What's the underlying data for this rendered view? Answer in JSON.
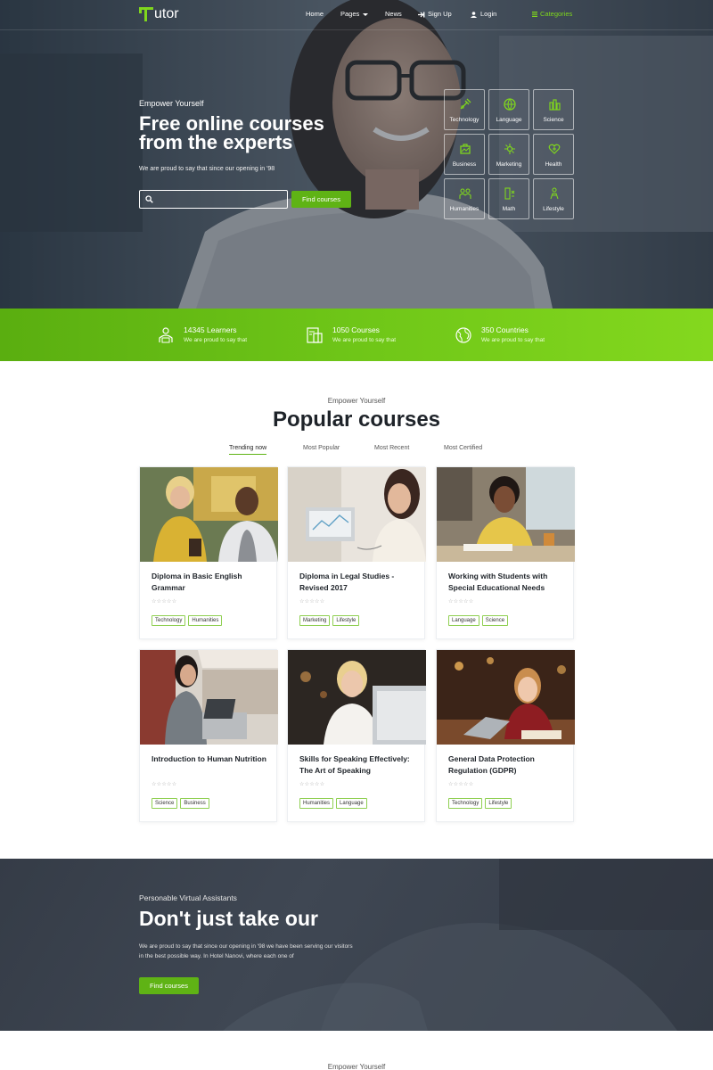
{
  "nav": {
    "logo_letter": "T",
    "logo_text": "utor",
    "home": "Home",
    "pages": "Pages",
    "news": "News",
    "signup": "Sign Up",
    "login": "Login",
    "categories": "Categories"
  },
  "hero": {
    "eyebrow": "Empower Yourself",
    "title_line1": "Free online courses",
    "title_line2": "from the experts",
    "subtitle": "We are proud to say that since our opening in '98",
    "search_placeholder": "",
    "button": "Find courses",
    "categories": [
      "Technology",
      "Language",
      "Science",
      "Business",
      "Marketing",
      "Health",
      "Humanities",
      "Math",
      "Lifestyle"
    ]
  },
  "stats": [
    {
      "number": "14345 Learners",
      "desc": "We are proud to say that",
      "icon": "learners-icon"
    },
    {
      "number": "1050 Courses",
      "desc": "We are proud to say that",
      "icon": "courses-icon"
    },
    {
      "number": "350 Countries",
      "desc": "We are proud to say that",
      "icon": "globe-icon"
    }
  ],
  "popular": {
    "eyebrow": "Empower Yourself",
    "title": "Popular courses",
    "tabs": [
      "Trending now",
      "Most Popular",
      "Most Recent",
      "Most Certified"
    ],
    "stars": "☆☆☆☆☆",
    "courses": [
      {
        "title": "Diploma in Basic English Grammar",
        "tags": [
          "Technology",
          "Humanities"
        ]
      },
      {
        "title": "Diploma in Legal Studies - Revised 2017",
        "tags": [
          "Marketing",
          "Lifestyle"
        ]
      },
      {
        "title": "Working with Students with Special Educational Needs",
        "tags": [
          "Language",
          "Science"
        ]
      },
      {
        "title": "Introduction to Human Nutrition",
        "tags": [
          "Science",
          "Business"
        ]
      },
      {
        "title": "Skills for Speaking Effectively: The Art of Speaking",
        "tags": [
          "Humanities",
          "Language"
        ]
      },
      {
        "title": "General Data Protection Regulation (GDPR)",
        "tags": [
          "Technology",
          "Lifestyle"
        ]
      }
    ]
  },
  "testimonial": {
    "eyebrow": "Personable Virtual Assistants",
    "title": "Don't just take our",
    "text": "We are proud to say that since our opening in '98 we have been serving our visitors in the best possible way. In Hotel Nanovi, where each one of",
    "button": "Find courses"
  },
  "bottom": {
    "eyebrow": "Empower Yourself"
  },
  "colors": {
    "accent": "#5fb315",
    "dark": "#3a414c"
  }
}
